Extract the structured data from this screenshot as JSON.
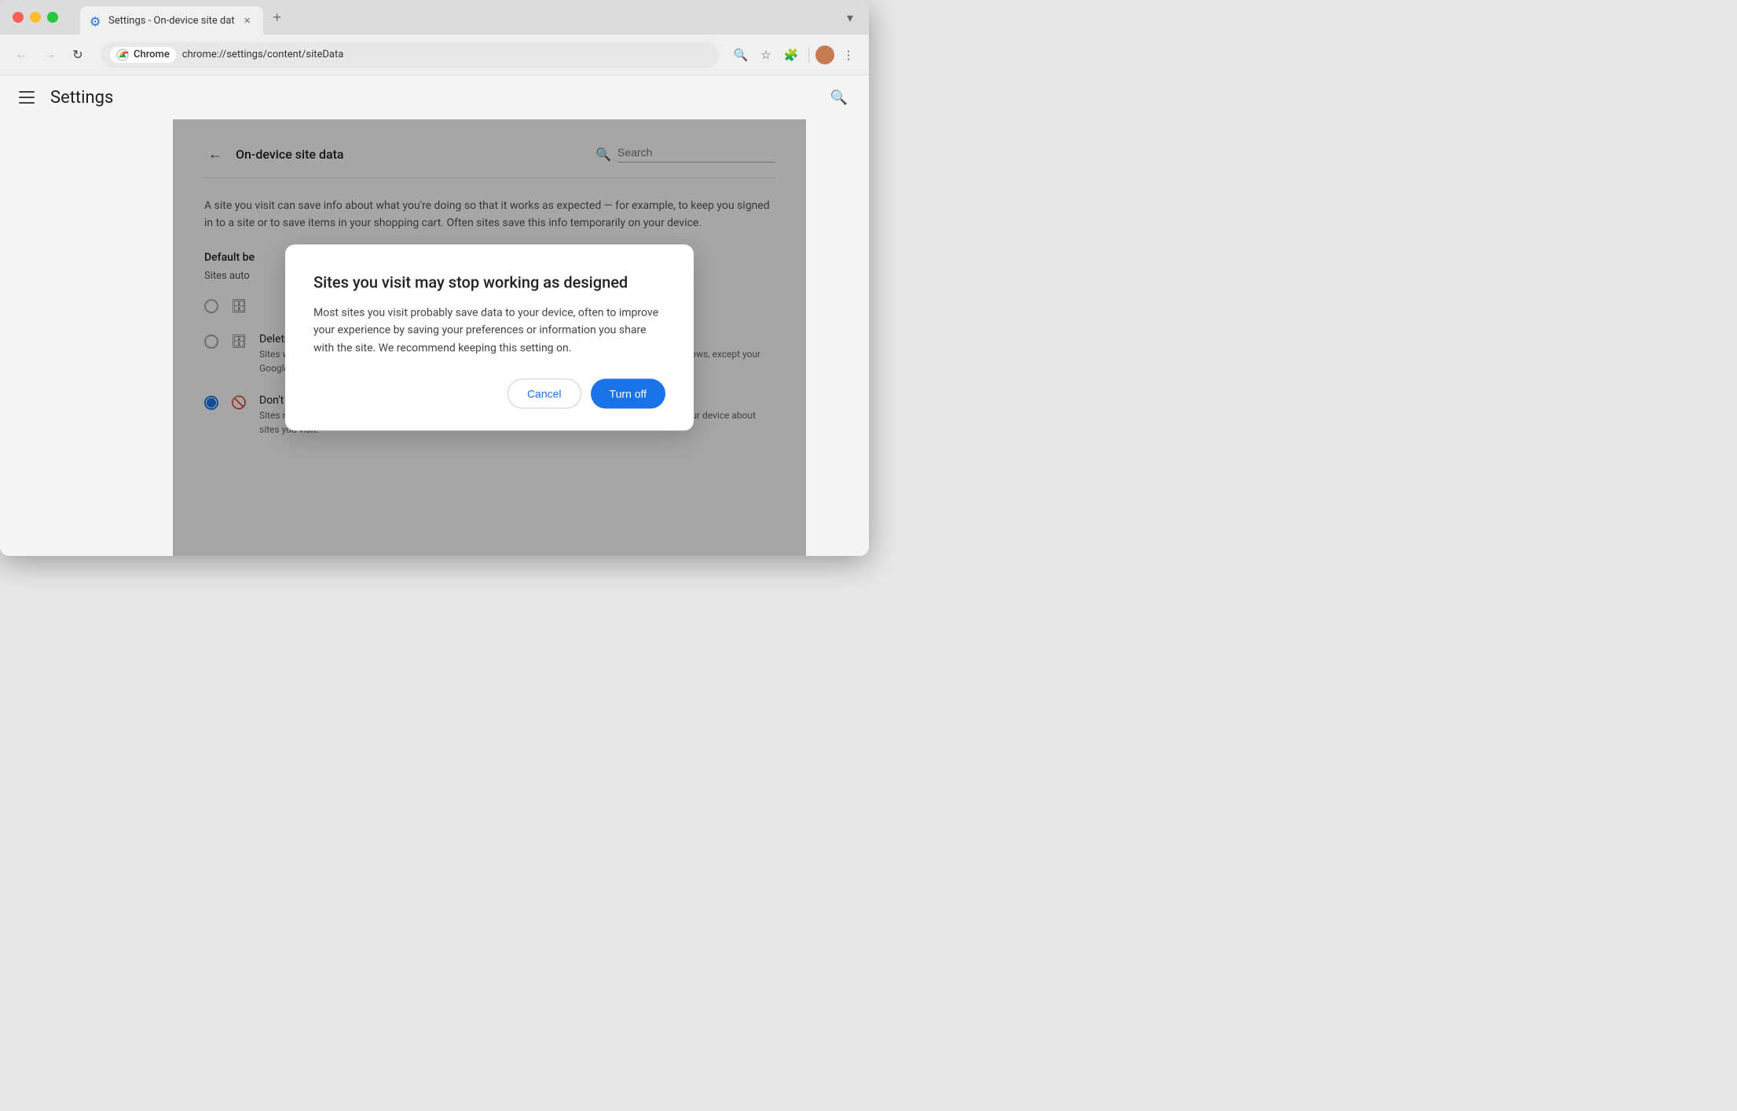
{
  "browser": {
    "tab_title": "Settings - On-device site dat",
    "tab_favicon": "⚙",
    "url": "chrome://settings/content/siteData",
    "site_badge_label": "Chrome",
    "new_tab_label": "+",
    "dropdown_label": "▾"
  },
  "nav": {
    "back_label": "←",
    "forward_label": "→",
    "refresh_label": "↻",
    "search_label": "🔍",
    "bookmark_label": "☆",
    "extensions_label": "🧩",
    "menu_label": "⋮"
  },
  "settings": {
    "menu_label": "☰",
    "title": "Settings",
    "search_label": "🔍"
  },
  "content": {
    "back_label": "←",
    "page_title": "On-device site data",
    "search_placeholder": "Search",
    "description": "A site you visit can save info about what you're doing so that it works as expected — for example, to keep you signed in to a site or to save items in your shopping cart. Often sites save this info temporarily on your device.",
    "default_behavior_label": "Default be",
    "sites_auto_label": "Sites auto",
    "options": [
      {
        "selected": false,
        "icon": "🗄",
        "title": "",
        "description": ""
      },
      {
        "selected": false,
        "icon": "🗄",
        "title": "Delete data sites have saved to your device when you close all windows",
        "description": "Sites will probably work as expected. You'll be signed out of most sites when you close all Chrome windows, except your Google Account if you're signed in to Chrome."
      },
      {
        "selected": true,
        "icon": "🚫",
        "title": "Don't allow sites to save data on your device (not recommended)",
        "description": "Sites may not work as you would expect. Choose this option if you don't want to leave information on your device about sites you visit."
      }
    ]
  },
  "dialog": {
    "title": "Sites you visit may stop working as designed",
    "body": "Most sites you visit probably save data to your device, often to improve your experience by saving your preferences or information you share with the site. We recommend keeping this setting on.",
    "cancel_label": "Cancel",
    "turn_off_label": "Turn off"
  }
}
